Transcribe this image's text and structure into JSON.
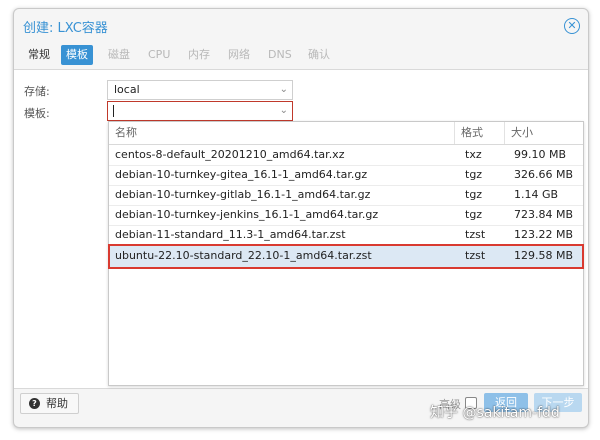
{
  "window": {
    "title": "创建: LXC容器",
    "close_icon": "close-circle-icon"
  },
  "tabs": [
    {
      "label": "常规",
      "state": "normal"
    },
    {
      "label": "模板",
      "state": "active"
    },
    {
      "label": "磁盘",
      "state": "disabled"
    },
    {
      "label": "CPU",
      "state": "disabled"
    },
    {
      "label": "内存",
      "state": "disabled"
    },
    {
      "label": "网络",
      "state": "disabled"
    },
    {
      "label": "DNS",
      "state": "disabled"
    },
    {
      "label": "确认",
      "state": "disabled"
    }
  ],
  "form": {
    "storage": {
      "label": "存储:",
      "value": "local"
    },
    "template": {
      "label": "模板:",
      "value": ""
    }
  },
  "dropdown": {
    "columns": [
      "名称",
      "格式",
      "大小"
    ],
    "rows": [
      {
        "name": "centos-8-default_20201210_amd64.tar.xz",
        "format": "txz",
        "size": "99.10 MB",
        "selected": false
      },
      {
        "name": "debian-10-turnkey-gitea_16.1-1_amd64.tar.gz",
        "format": "tgz",
        "size": "326.66 MB",
        "selected": false
      },
      {
        "name": "debian-10-turnkey-gitlab_16.1-1_amd64.tar.gz",
        "format": "tgz",
        "size": "1.14 GB",
        "selected": false
      },
      {
        "name": "debian-10-turnkey-jenkins_16.1-1_amd64.tar.gz",
        "format": "tgz",
        "size": "723.84 MB",
        "selected": false
      },
      {
        "name": "debian-11-standard_11.3-1_amd64.tar.zst",
        "format": "tzst",
        "size": "123.22 MB",
        "selected": false
      },
      {
        "name": "ubuntu-22.10-standard_22.10-1_amd64.tar.zst",
        "format": "tzst",
        "size": "129.58 MB",
        "selected": true
      }
    ]
  },
  "footer": {
    "help_label": "帮助",
    "advanced_label": "高级",
    "back_label": "返回",
    "next_label": "下一步"
  },
  "watermark": "知乎 @sakitam-fdd",
  "colors": {
    "accent": "#3892d4",
    "selection_outline": "#d93a30",
    "selected_row": "#dce8f4"
  }
}
